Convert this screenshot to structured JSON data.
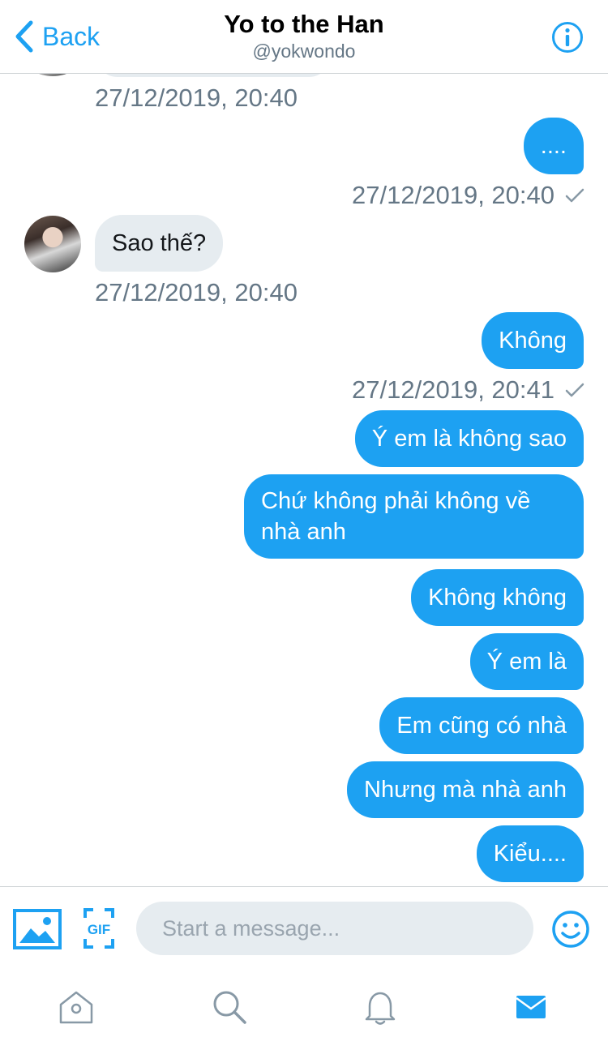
{
  "header": {
    "back_label": "Back",
    "title": "Yo to the Han",
    "handle": "@yokwondo",
    "info_icon": "info-icon"
  },
  "messages": [
    {
      "from": "them",
      "timestamp": "27/12/2019, 20:40"
    },
    {
      "from": "me",
      "text": "....",
      "timestamp": "27/12/2019, 20:40",
      "read": true
    },
    {
      "from": "them",
      "text": "Sao thế?",
      "timestamp": "27/12/2019, 20:40"
    },
    {
      "from": "me",
      "text": "Không",
      "timestamp": "27/12/2019, 20:41",
      "read": true
    },
    {
      "from": "me",
      "text": "Ý em là không sao"
    },
    {
      "from": "me",
      "text": "Chứ không phải không về nhà anh"
    },
    {
      "from": "me",
      "text": "Không không"
    },
    {
      "from": "me",
      "text": "Ý em là"
    },
    {
      "from": "me",
      "text": "Em cũng có nhà"
    },
    {
      "from": "me",
      "text": "Nhưng mà nhà anh"
    },
    {
      "from": "me",
      "text": "Kiểu...."
    }
  ],
  "composer": {
    "placeholder": "Start a message...",
    "icons": [
      "image-icon",
      "gif-icon",
      "emoji-icon"
    ]
  },
  "tabbar": {
    "tabs": [
      "home-icon",
      "search-icon",
      "notifications-icon",
      "messages-icon"
    ],
    "active": "messages-icon"
  },
  "colors": {
    "accent": "#1da1f2",
    "incoming_bubble": "#e6ecf0",
    "secondary_text": "#657786"
  }
}
